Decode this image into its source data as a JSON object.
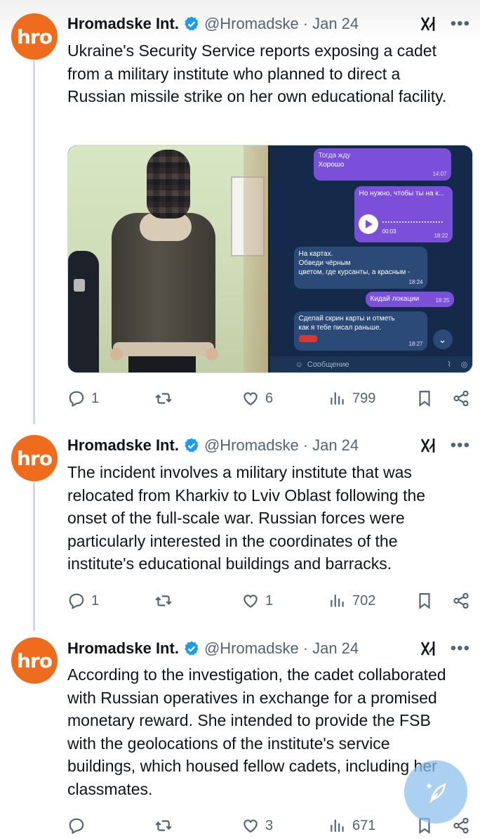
{
  "author": {
    "display_name": "Hromadske Int.",
    "handle": "@Hromadske",
    "avatar_text": "hro",
    "avatar_color": "#ef6b1d",
    "verified_color": "#1d9bf0"
  },
  "separator": "·",
  "tweets": [
    {
      "date": "Jan 24",
      "text": "Ukraine's Security Service reports exposing a cadet from a military institute who planned to direct a Russian missile strike on her own educational facility.",
      "replies": "1",
      "retweets": "",
      "likes": "6",
      "views": "799"
    },
    {
      "date": "Jan 24",
      "text": "The incident involves a military institute that was relocated from Kharkiv to Lviv Oblast following the onset of the full-scale war. Russian forces were particularly interested in the coordinates of the institute's educational buildings and barracks.",
      "replies": "1",
      "retweets": "",
      "likes": "1",
      "views": "702"
    },
    {
      "date": "Jan 24",
      "text": "According to the investigation, the cadet collaborated with Russian operatives in exchange for a promised monetary reward. She intended to provide the FSB with the geolocations of the institute's service buildings, which housed fellow cadets, including her classmates.",
      "replies": "",
      "retweets": "",
      "likes": "3",
      "views": "671"
    }
  ],
  "media": {
    "chat": {
      "msg1_line1": "Тогда жду",
      "msg1_line2": "Хорошо",
      "msg1_time": "14:07",
      "msg2_line": "Но нужно, чтобы ты на к...",
      "voice_duration": "00:03",
      "msg2_time": "18:22",
      "msg3_line1": "На картах.",
      "msg3_line2": "Обведи чёрным",
      "msg3_line3": "цветом, где курсанты, а красным -",
      "msg3_time": "18:24",
      "msg4_line": "Кидай локации",
      "msg4_time": "18:25",
      "msg5_line1": "Сделай скрин карты и отметь",
      "msg5_line2": "как я тебе писал раньше.",
      "msg5_time": "18:27",
      "input_placeholder": "Сообщение"
    }
  }
}
